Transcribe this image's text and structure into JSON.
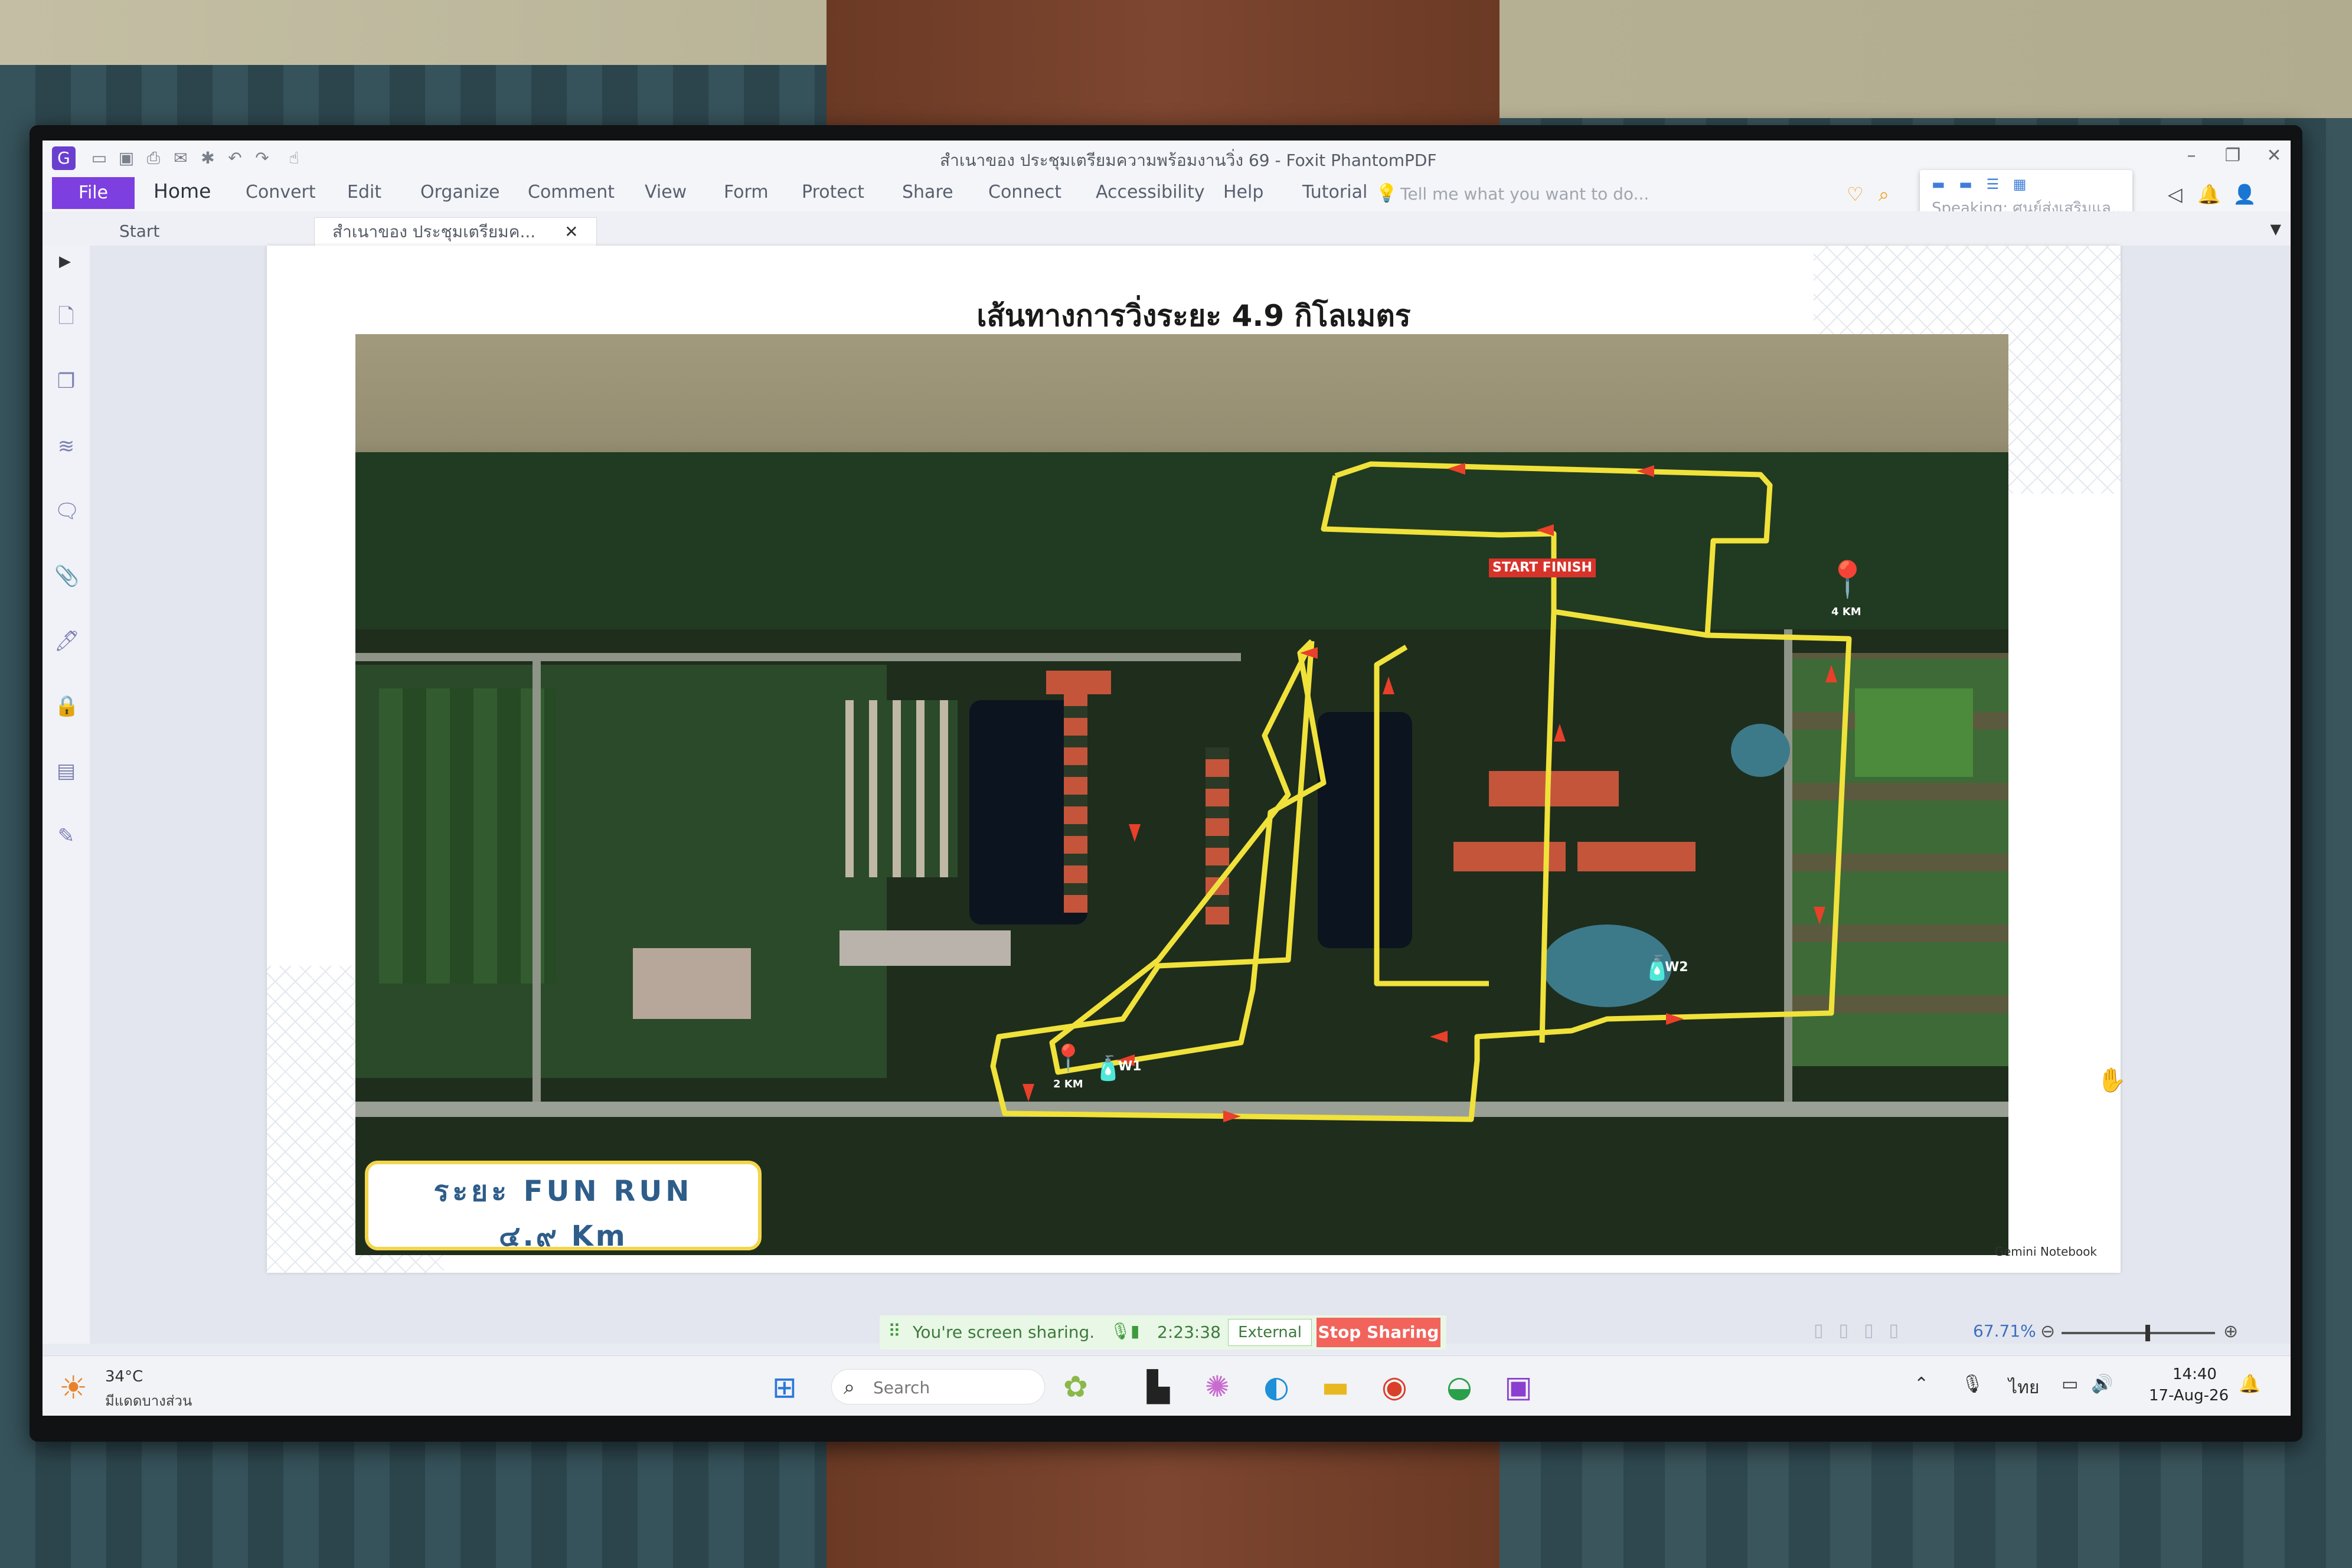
{
  "app": {
    "title": "สำเนาของ ประชุมเตรียมความพร้อมงานวิ่ง 69 - Foxit PhantomPDF",
    "speaking_label": "Speaking: ศูนย์ส่งเสริมแล..."
  },
  "menu": {
    "file": "File",
    "items": [
      "Home",
      "Convert",
      "Edit",
      "Organize",
      "Comment",
      "View",
      "Form",
      "Protect",
      "Share",
      "Connect",
      "Accessibility",
      "Help",
      "Tutorial"
    ],
    "tell_me": "Tell me what you want to do..."
  },
  "tabs": {
    "start": "Start",
    "document": "สำเนาของ ประชุมเตรียมค..."
  },
  "slide": {
    "title": "เส้นทางการวิ่งระยะ 4.9 กิโลเมตร",
    "fun_run_line1": "ระยะ FUN RUN",
    "fun_run_line2": "๔.๙ Km",
    "start_finish": "START FINISH",
    "marker_4km": "4 KM",
    "marker_2km": "2 KM",
    "water_w1": "W1",
    "water_w2": "W2",
    "credit": "Gemini Notebook"
  },
  "sharing": {
    "message": "You're screen sharing.",
    "timer": "2:23:38",
    "external": "External",
    "stop": "Stop Sharing"
  },
  "viewer": {
    "zoom": "67.71%"
  },
  "taskbar": {
    "temperature": "34°C",
    "weather_desc": "มีแดดบางส่วน",
    "search_placeholder": "Search",
    "language": "ไทย",
    "time": "14:40",
    "date": "17-Aug-26"
  },
  "colors": {
    "route": "#f0e23a",
    "arrow": "#e8402a",
    "accent": "#7d3fe0",
    "stop_sharing": "#f2635b"
  }
}
